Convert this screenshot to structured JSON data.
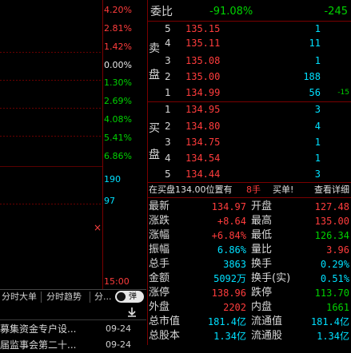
{
  "chart": {
    "percent_labels": [
      {
        "text": "4.20%",
        "color": "red"
      },
      {
        "text": "2.81%",
        "color": "red"
      },
      {
        "text": "1.42%",
        "color": "red"
      },
      {
        "text": "0.00%",
        "color": "white"
      },
      {
        "text": "1.30%",
        "color": "green"
      },
      {
        "text": "2.69%",
        "color": "green"
      },
      {
        "text": "4.08%",
        "color": "green"
      },
      {
        "text": "5.41%",
        "color": "green"
      },
      {
        "text": "6.86%",
        "color": "green"
      }
    ],
    "volume_labels": [
      "190",
      "97"
    ],
    "close_symbol": "×",
    "time_label": "15:00"
  },
  "tabs": {
    "items": [
      "分时大单",
      "分时趋势",
      "分..."
    ],
    "toggle_label": "弹"
  },
  "news": [
    {
      "text": "募集资金专户设...",
      "date": "09-24"
    },
    {
      "text": "届监事会第二十...",
      "date": "09-24"
    }
  ],
  "order_book": {
    "ratio_label": "委比",
    "ratio_value": "-91.08%",
    "ratio_diff": "-245",
    "sell_label_1": "卖",
    "sell_label_2": "盘",
    "buy_label_1": "买",
    "buy_label_2": "盘",
    "sell": [
      {
        "level": "5",
        "price": "135.15",
        "volume": "1",
        "change": ""
      },
      {
        "level": "4",
        "price": "135.11",
        "volume": "11",
        "change": ""
      },
      {
        "level": "3",
        "price": "135.08",
        "volume": "1",
        "change": ""
      },
      {
        "level": "2",
        "price": "135.00",
        "volume": "188",
        "change": ""
      },
      {
        "level": "1",
        "price": "134.99",
        "volume": "56",
        "change": "-15"
      }
    ],
    "buy": [
      {
        "level": "1",
        "price": "134.95",
        "volume": "3"
      },
      {
        "level": "2",
        "price": "134.80",
        "volume": "4"
      },
      {
        "level": "3",
        "price": "134.75",
        "volume": "1"
      },
      {
        "level": "4",
        "price": "134.54",
        "volume": "1"
      },
      {
        "level": "5",
        "price": "134.44",
        "volume": "3"
      }
    ]
  },
  "notice": {
    "prefix": "在买盘134.00位置有",
    "amount": "8手",
    "action": "买单!",
    "link": "查看详细"
  },
  "stats": [
    {
      "k": "最新",
      "v": "134.97",
      "vc": "red",
      "k2": "开盘",
      "v2": "127.48",
      "v2c": "red"
    },
    {
      "k": "涨跌",
      "v": "+8.64",
      "vc": "red",
      "k2": "最高",
      "v2": "135.00",
      "v2c": "red"
    },
    {
      "k": "涨幅",
      "v": "+6.84%",
      "vc": "red",
      "k2": "最低",
      "v2": "126.34",
      "v2c": "green"
    },
    {
      "k": "振幅",
      "v": "6.86%",
      "vc": "cyan",
      "k2": "量比",
      "v2": "3.96",
      "v2c": "red"
    },
    {
      "k": "总手",
      "v": "3863",
      "vc": "cyan",
      "k2": "换手",
      "v2": "0.29%",
      "v2c": "cyan"
    },
    {
      "k": "金额",
      "v": "5092万",
      "vc": "cyan",
      "k2": "换手(实)",
      "v2": "0.51%",
      "v2c": "cyan"
    },
    {
      "k": "涨停",
      "v": "138.96",
      "vc": "red",
      "k2": "跌停",
      "v2": "113.70",
      "v2c": "green"
    },
    {
      "k": "外盘",
      "v": "2202",
      "vc": "red",
      "k2": "内盘",
      "v2": "1661",
      "v2c": "green"
    },
    {
      "k": "总市值",
      "v": "181.4亿",
      "vc": "cyan",
      "k2": "流通值",
      "v2": "181.4亿",
      "v2c": "cyan"
    },
    {
      "k": "总股本",
      "v": "1.34亿",
      "vc": "cyan",
      "k2": "流通股",
      "v2": "1.34亿",
      "v2c": "cyan"
    }
  ]
}
